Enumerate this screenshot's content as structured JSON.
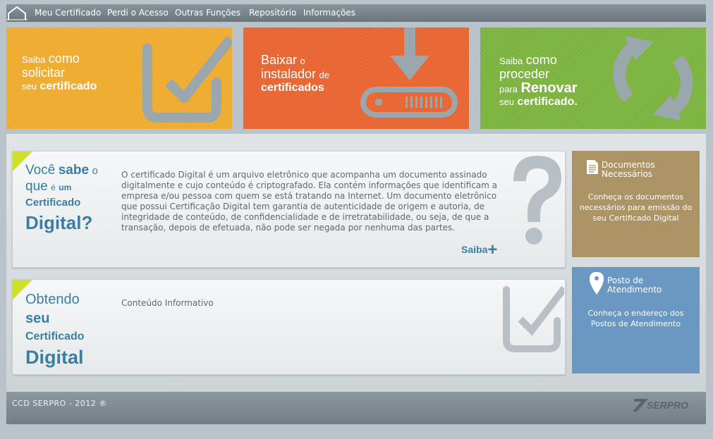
{
  "nav": {
    "items": [
      "Meu Certificado",
      "Perdi o Acesso",
      "Outras Funções",
      "Repositório",
      "Informações"
    ],
    "home_icon": "home-icon"
  },
  "banners": [
    {
      "lines": [
        [
          "Saiba",
          "como"
        ],
        [
          "solicitar"
        ],
        [
          "seu",
          "certificado"
        ]
      ],
      "color": "#eeab2e",
      "icon": "check-box-icon"
    },
    {
      "lines": [
        [
          "Baixar",
          "o"
        ],
        [
          "instalador",
          "de"
        ],
        [
          "certificados"
        ]
      ],
      "color": "#e86431",
      "icon": "download-drive-icon"
    },
    {
      "lines": [
        [
          "Saiba",
          "como"
        ],
        [
          "proceder"
        ],
        [
          "para",
          "Renovar"
        ],
        [
          "seu",
          "certificado."
        ]
      ],
      "color": "#7cb33e",
      "icon": "renew-arrows-icon"
    }
  ],
  "card1": {
    "title": [
      "Você",
      "sabe",
      "o",
      "que",
      "é",
      "um",
      "Certificado",
      "Digital?"
    ],
    "text": "O certificado Digital é um arquivo eletrônico que acompanha um documento assinado digitalmente e cujo conteúdo é criptografado. Ela contém informações que identificam a empresa e/ou pessoa com quem se está tratando na Internet. Um documento eletrônico que possui Certificação Digital tem garantia de autenticidade de origem e autoria, de integridade de conteúdo, de confidencialidade e de irretratabilidade, ou seja, de que a transação, depois de efetuada, não pode ser negada por nenhuma das partes.",
    "more_label": "Saiba",
    "more_icon": "plus-icon"
  },
  "card2": {
    "title": [
      "Obtendo",
      "seu",
      "Certificado",
      "Digital"
    ],
    "text": "Conteúdo Informativo"
  },
  "side1": {
    "title": "Documentos Necessários",
    "text": "Conheça os documentos necessários para emissão do seu Certificado Digital",
    "color": "#ad9466"
  },
  "side2": {
    "title": "Posto de Atendimento",
    "text": "Conheça o endereço dos Postos de Atendimento",
    "color": "#6b98c3"
  },
  "footer": {
    "copyright": "CCD SERPRO - 2012 ®",
    "logo_text": "SERPRO"
  },
  "colors": {
    "accent_blue": "#3a7fa1",
    "corner_yellow": "#cfe026"
  }
}
